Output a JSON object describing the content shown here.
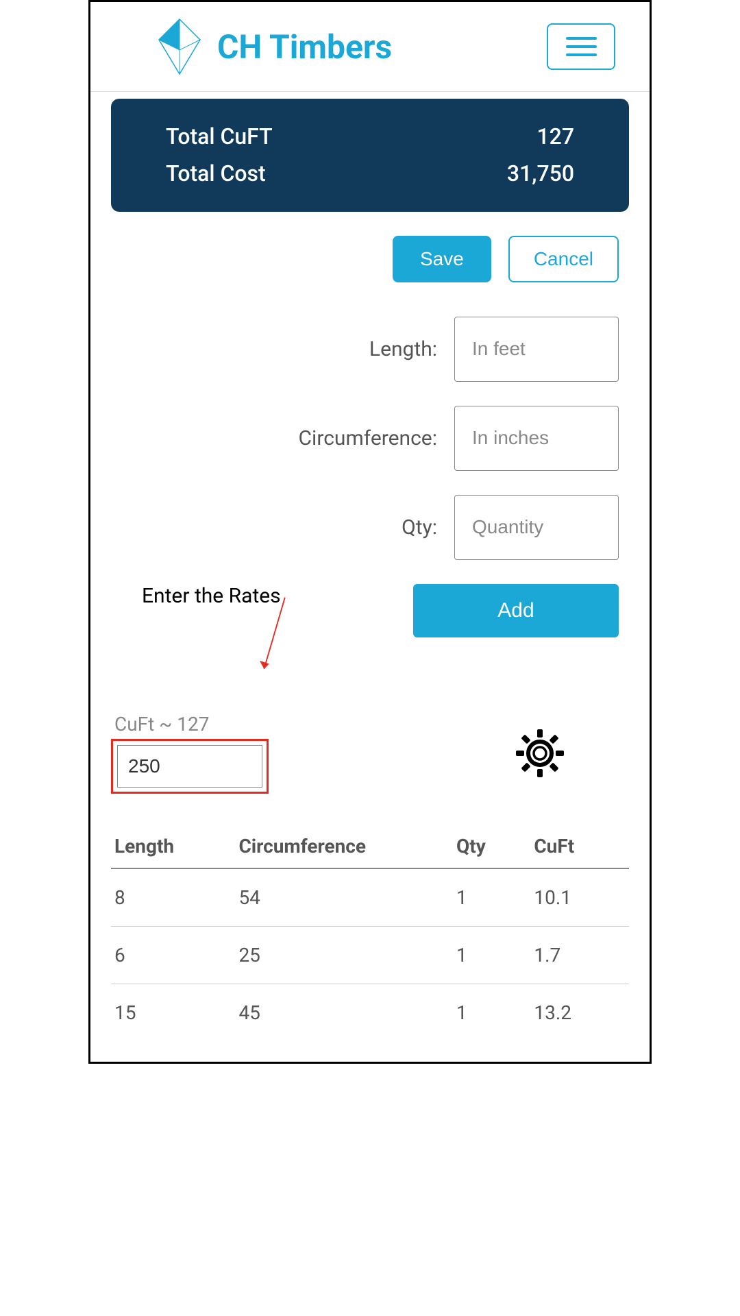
{
  "header": {
    "brand": "CH Timbers"
  },
  "totals": {
    "cuft_label": "Total CuFT",
    "cuft_value": "127",
    "cost_label": "Total Cost",
    "cost_value": "31,750"
  },
  "actions": {
    "save_label": "Save",
    "cancel_label": "Cancel",
    "add_label": "Add"
  },
  "form": {
    "length_label": "Length:",
    "length_placeholder": "In feet",
    "circumference_label": "Circumference:",
    "circumference_placeholder": "In inches",
    "qty_label": "Qty:",
    "qty_placeholder": "Quantity"
  },
  "annotation": {
    "rates_text": "Enter the Rates"
  },
  "cuft": {
    "label": "CuFt ~ 127",
    "rate_value": "250"
  },
  "table": {
    "headers": {
      "length": "Length",
      "circumference": "Circumference",
      "qty": "Qty",
      "cuft": "CuFt"
    },
    "rows": [
      {
        "length": "8",
        "circumference": "54",
        "qty": "1",
        "cuft": "10.1"
      },
      {
        "length": "6",
        "circumference": "25",
        "qty": "1",
        "cuft": "1.7"
      },
      {
        "length": "15",
        "circumference": "45",
        "qty": "1",
        "cuft": "13.2"
      }
    ]
  }
}
